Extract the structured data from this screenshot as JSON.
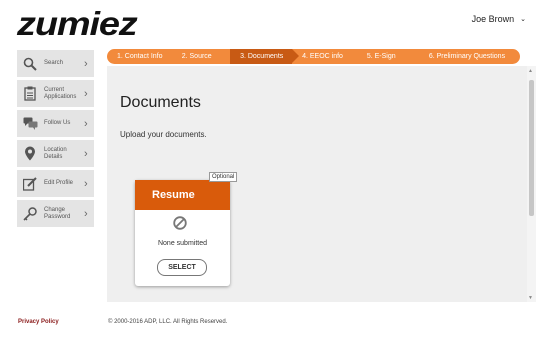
{
  "brand": {
    "logo_text": "zumiez"
  },
  "user": {
    "name": "Joe Brown",
    "chevron_icon": "chevron-down-icon"
  },
  "sidebar": {
    "items": [
      {
        "label": "Search",
        "icon": "search-icon"
      },
      {
        "label": "Current Applications",
        "icon": "clipboard-icon"
      },
      {
        "label": "Follow Us",
        "icon": "chat-bubbles-icon"
      },
      {
        "label": "Location Details",
        "icon": "map-pin-icon"
      },
      {
        "label": "Edit Profile",
        "icon": "edit-icon"
      },
      {
        "label": "Change Password",
        "icon": "key-icon"
      }
    ]
  },
  "steps": [
    {
      "label": "1. Contact Info"
    },
    {
      "label": "2. Source"
    },
    {
      "label": "3. Documents",
      "active": true
    },
    {
      "label": "4. EEOC info"
    },
    {
      "label": "5. E-Sign"
    },
    {
      "label": "6. Preliminary Questions"
    }
  ],
  "main": {
    "title": "Documents",
    "subtitle": "Upload your documents."
  },
  "card": {
    "title": "Resume",
    "badge": "Optional",
    "status_text": "None submitted",
    "status_icon": "prohibited-icon",
    "button_label": "SELECT"
  },
  "footer": {
    "privacy": "Privacy Policy",
    "copyright": "© 2000-2016 ADP, LLC. All Rights Reserved."
  },
  "colors": {
    "accent": "#d95b0b",
    "step_bar": "#f28a3c",
    "step_active": "#c85a14"
  }
}
